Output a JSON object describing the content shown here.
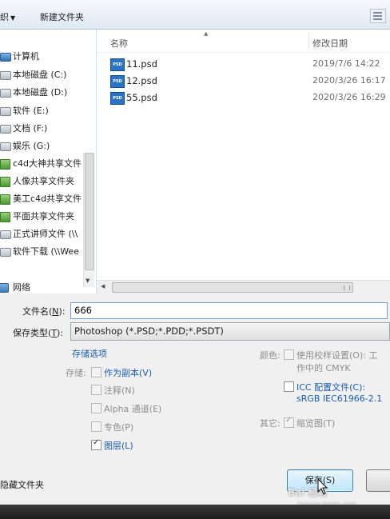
{
  "toolbar": {
    "organize_partial": "织",
    "new_folder": "新建文件夹"
  },
  "nav": {
    "computer": "计算机",
    "items": [
      "本地磁盘 (C:)",
      "本地磁盘 (D:)",
      "软件 (E:)",
      "文档 (F:)",
      "娱乐 (G:)",
      "c4d大神共享文件",
      "人像共享文件夹",
      "美工c4d共享文件",
      "平面共享文件夹",
      "正式讲师文件 (\\\\",
      "软件下载 (\\\\Wee"
    ],
    "network": "网络"
  },
  "files": {
    "header_name": "名称",
    "header_date": "修改日期",
    "rows": [
      {
        "icon": "PSD",
        "name": "11.psd",
        "date": "2019/7/6 14:22"
      },
      {
        "icon": "PSD",
        "name": "12.psd",
        "date": "2020/3/26 16:17"
      },
      {
        "icon": "PSD",
        "name": "55.psd",
        "date": "2020/3/26 16:29"
      }
    ]
  },
  "form": {
    "filename_label": "文件名(",
    "filename_key": "N",
    "filename_label_end": "):",
    "filename_value": "666",
    "type_label": "保存类型(",
    "type_key": "T",
    "type_label_end": "):",
    "type_value": "Photoshop (*.PSD;*.PDD;*.PSDT)"
  },
  "options": {
    "title": "存储选项",
    "save_label": "存储:",
    "as_copy": "作为副本(V)",
    "notes": "注释(N)",
    "alpha": "Alpha 通道(E)",
    "spot": "专色(P)",
    "layers": "图层(L)",
    "color_label": "颜色:",
    "proof_line1": "使用校样设置(O):",
    "proof_line1_tail": "工",
    "proof_line2": "作中的 CMYK",
    "icc_line1": "ICC 配置文件(C):",
    "icc_line2": "sRGB IEC61966-2.1",
    "other_label": "其它:",
    "thumbnail": "缩览图(T)"
  },
  "checks": {
    "as_copy": false,
    "notes": false,
    "alpha": false,
    "spot": false,
    "layers": true,
    "proof": false,
    "icc": false,
    "thumbnail": true
  },
  "bottom": {
    "hide_folders": "隐藏文件夹",
    "save_button": "保存(S)"
  },
  "watermark": {
    "line1": "Bai 经验",
    "line2": "jingyan.baidu.com"
  }
}
